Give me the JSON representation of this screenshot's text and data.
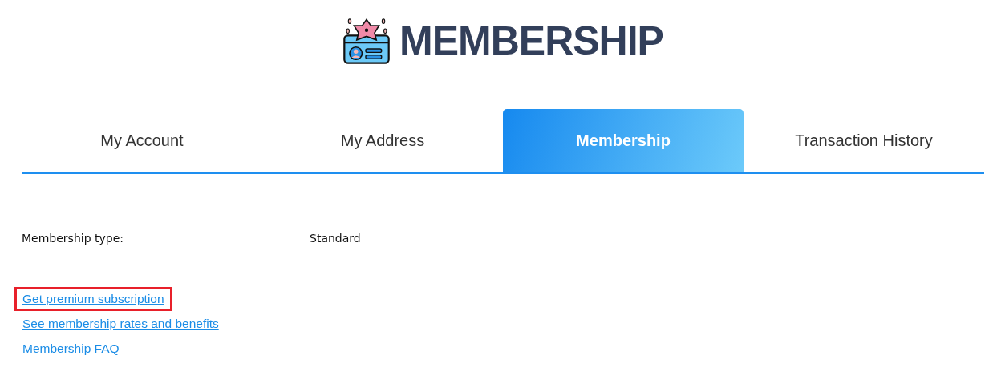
{
  "header": {
    "title": "MEMBERSHIP"
  },
  "tabs": [
    {
      "label": "My Account",
      "selected": false
    },
    {
      "label": "My Address",
      "selected": false
    },
    {
      "label": "Membership",
      "selected": true
    },
    {
      "label": "Transaction History",
      "selected": false
    }
  ],
  "details": [
    {
      "label": "Membership type:",
      "value": "Standard"
    }
  ],
  "links": [
    {
      "label": "Get premium subscription",
      "highlighted": true
    },
    {
      "label": "See membership rates and benefits",
      "highlighted": false
    },
    {
      "label": "Membership FAQ",
      "highlighted": false
    }
  ]
}
